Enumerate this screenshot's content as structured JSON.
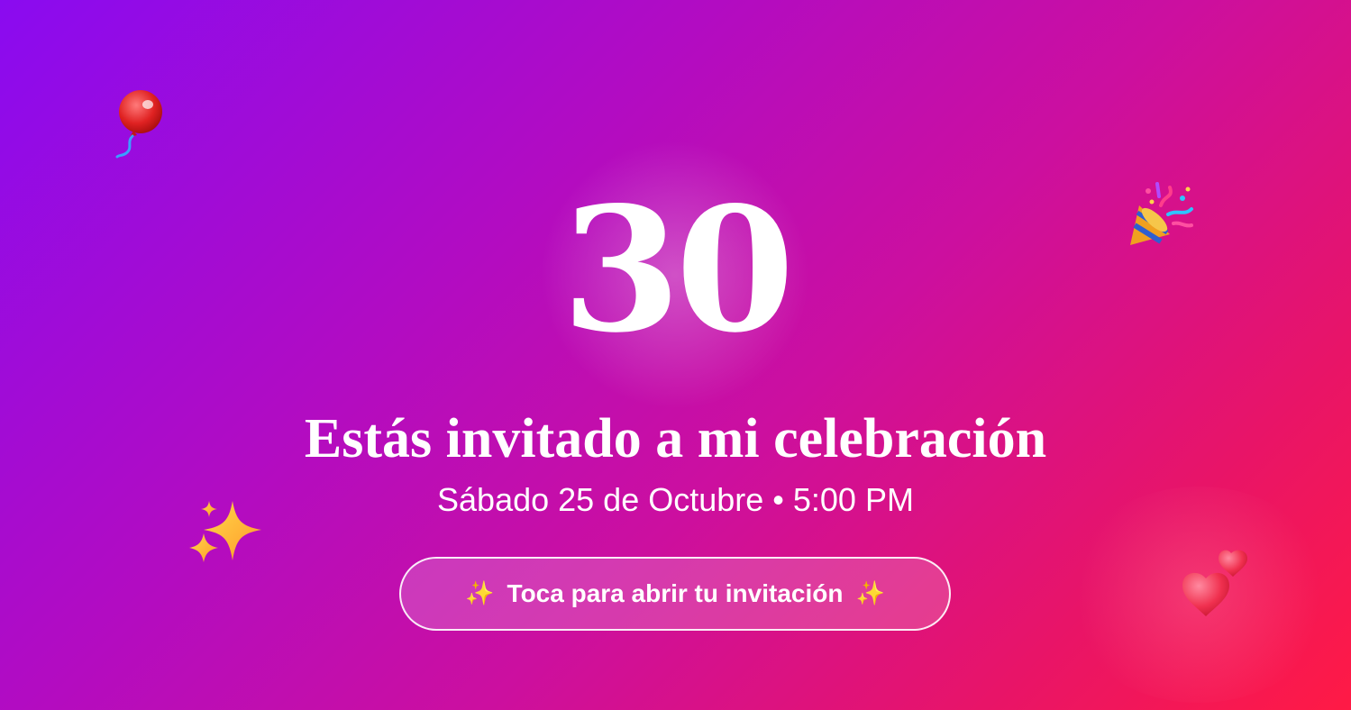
{
  "invitation": {
    "age_number": "30",
    "headline": "Estás invitado a mi celebración",
    "date_time": "Sábado 25 de Octubre • 5:00 PM",
    "open_button_label": "Toca para abrir tu invitación",
    "open_button_spark": "✨"
  },
  "decorations": {
    "icons": [
      "balloon-icon",
      "party-popper-icon",
      "sparkles-icon",
      "hearts-icon"
    ]
  },
  "colors": {
    "gradient_start": "#8a0bf0",
    "gradient_mid": "#cc0f9f",
    "gradient_end": "#ff1a45",
    "text": "#ffffff"
  }
}
